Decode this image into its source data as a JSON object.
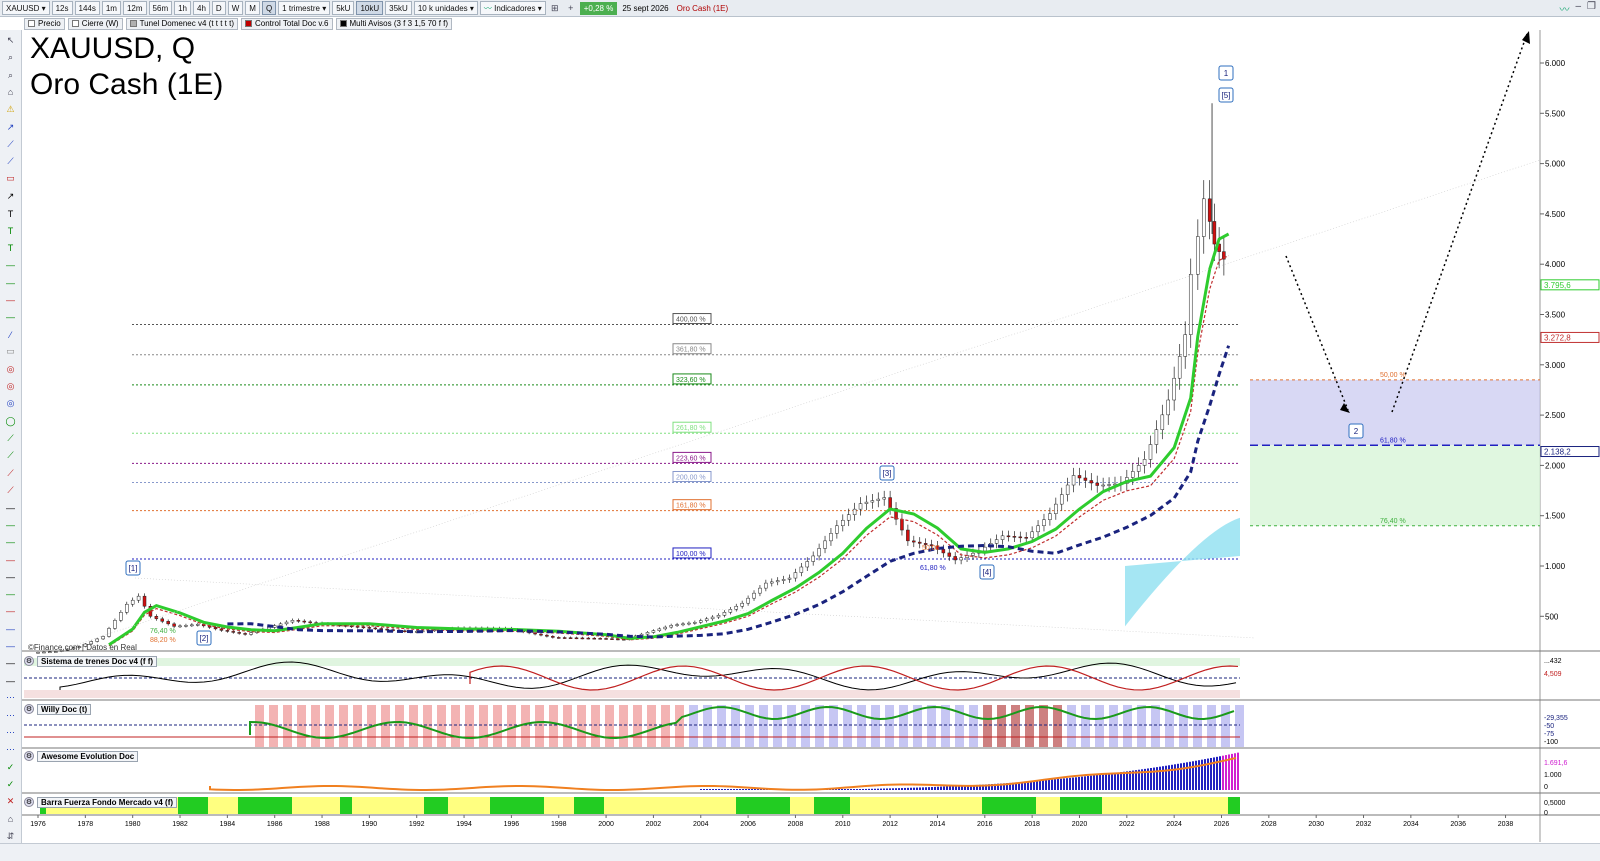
{
  "toolbar": {
    "symbol": "XAUUSD",
    "intervals": [
      "12s",
      "144s",
      "1m",
      "12m",
      "56m",
      "1h",
      "4h",
      "D",
      "W",
      "M",
      "Q"
    ],
    "active_interval": "Q",
    "period": "1 trimestre",
    "units_buttons": [
      "5kU",
      "10kU",
      "35kU"
    ],
    "active_unit": "10kU",
    "units_select": "10 k unidades",
    "indicators_label": "Indicadores",
    "change_badge": "+0,28 %",
    "date": "25 sept 2026",
    "instrument_name": "Oro Cash (1E)"
  },
  "studies": [
    {
      "label": "Precio",
      "color": "#ffffff"
    },
    {
      "label": "Cierre (W)",
      "color": "#ffffff"
    },
    {
      "label": "Tunel Domenec v4 (t t t t t)",
      "color": "#b0b0b0"
    },
    {
      "label": "Control Total Doc v.6",
      "color": "#c00000"
    },
    {
      "label": "Multi Avisos (3 f 3 1,5 70 f f)",
      "color": "#000000"
    }
  ],
  "title_line1": "XAUUSD, Q",
  "title_line2": "Oro Cash (1E)",
  "source_note": "©Finance.com | Datos en Real",
  "price_axis": [
    "6.000",
    "5.500",
    "5.000",
    "4.500",
    "4.000",
    "3.500",
    "3.000",
    "2.500",
    "2.000",
    "1.500",
    "1.000",
    "500"
  ],
  "price_labels": {
    "last": "3.795,6",
    "red": "3.272,8",
    "blue": "2.138,2"
  },
  "fib_levels": [
    {
      "label": "400,00 %",
      "color": "#555555"
    },
    {
      "label": "361,80 %",
      "color": "#888888"
    },
    {
      "label": "323,60 %",
      "color": "#1a8a1a"
    },
    {
      "label": "261,80 %",
      "color": "#80e080"
    },
    {
      "label": "223,60 %",
      "color": "#8a1a8a"
    },
    {
      "label": "200,00 %",
      "color": "#8899cc"
    },
    {
      "label": "161,80 %",
      "color": "#e07030"
    },
    {
      "label": "100,00 %",
      "color": "#2020c0"
    }
  ],
  "projection_levels": [
    {
      "label": "50,00 %",
      "color": "#e07030"
    },
    {
      "label": "61,80 %",
      "color": "#2020c0"
    },
    {
      "label": "76,40 %",
      "color": "#40b040"
    }
  ],
  "wave_labels": [
    "1",
    "[5]",
    "[3]",
    "[4]",
    "[1]",
    "[2]",
    "2"
  ],
  "minor_labels": [
    "76,40 %",
    "88,20 %",
    "50,00",
    "61,80 %"
  ],
  "x_axis": [
    "1976",
    "1978",
    "1980",
    "1982",
    "1984",
    "1986",
    "1988",
    "1990",
    "1992",
    "1994",
    "1996",
    "1998",
    "2000",
    "2002",
    "2004",
    "2006",
    "2008",
    "2010",
    "2012",
    "2014",
    "2016",
    "2018",
    "2020",
    "2022",
    "2024",
    "2026",
    "2028",
    "2030",
    "2032",
    "2034",
    "2036",
    "2038"
  ],
  "panes": [
    {
      "name": "Sistema de trenes Doc v4 (f f)",
      "values": [
        "...432",
        "4,509"
      ]
    },
    {
      "name": "Willy Doc (t)",
      "values": [
        "-29,355",
        "-50",
        "-75",
        "-100"
      ]
    },
    {
      "name": "Awesome Evolution Doc",
      "values": [
        "1.691,6",
        "1.000",
        "0"
      ]
    },
    {
      "name": "Barra Fuerza Fondo Mercado v4 (f)",
      "values": [
        "0,5000",
        "0"
      ]
    }
  ],
  "colors": {
    "ema_green": "#2ecc2e",
    "ema_red": "#c03030",
    "ema_blue": "#1a237e",
    "projection_blue": "#c8c8f0",
    "projection_green": "#d8f5d8",
    "cloud_cyan": "#8ee0f0"
  }
}
